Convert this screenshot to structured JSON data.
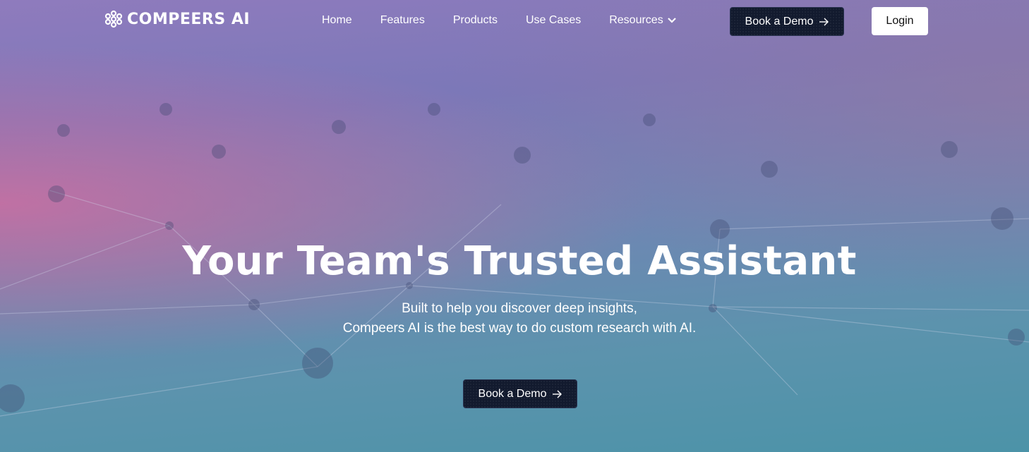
{
  "brand": {
    "name": "COMPEERS AI"
  },
  "nav": {
    "items": [
      {
        "label": "Home"
      },
      {
        "label": "Features"
      },
      {
        "label": "Products"
      },
      {
        "label": "Use Cases"
      },
      {
        "label": "Resources",
        "icon": "chevron-down-icon"
      }
    ],
    "demo_label": "Book a Demo",
    "login_label": "Login"
  },
  "hero": {
    "title": "Your Team's Trusted Assistant",
    "subtitle_line1": "Built to help you discover deep insights,",
    "subtitle_line2": "Compeers AI is the best way to do custom research with AI.",
    "cta_label": "Book a Demo",
    "cta_icon": "arrow-right-icon"
  },
  "colors": {
    "button_dark": "#121a2e",
    "login_bg": "#ffffff",
    "text": "#ffffff"
  }
}
